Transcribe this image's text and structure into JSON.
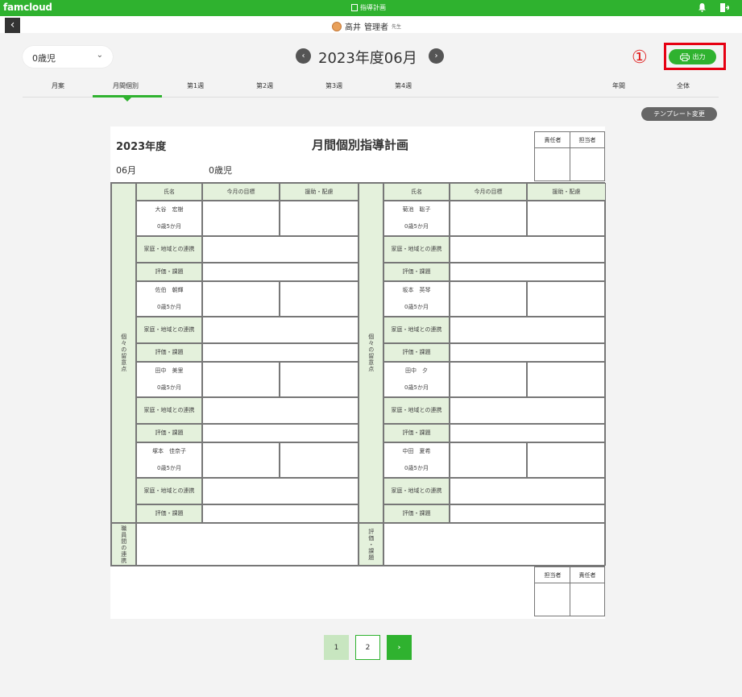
{
  "app": {
    "brand": "famcloud",
    "screen_title": "指導計画",
    "user_name": "高井",
    "user_role": "管理者",
    "user_suffix": "先生"
  },
  "toolbar": {
    "age_select_value": "0歳児",
    "month_label": "2023年度06月",
    "print_label": "出力",
    "annotation_marker": "①",
    "template_change_label": "テンプレート変更"
  },
  "tabs": [
    {
      "label": "月案"
    },
    {
      "label": "月間個別"
    },
    {
      "label": "第1週"
    },
    {
      "label": "第2週"
    },
    {
      "label": "第3週"
    },
    {
      "label": "第4週"
    },
    {
      "label": "年間"
    },
    {
      "label": "全体"
    }
  ],
  "document": {
    "year": "2023年度",
    "title": "月間個別指導計画",
    "month": "06月",
    "class": "0歳児",
    "top_sign_headers": [
      "責任者",
      "担当者"
    ],
    "bottom_sign_headers": [
      "担当者",
      "責任者"
    ],
    "column_headers": [
      "氏名",
      "今月の目標",
      "援助・配慮"
    ],
    "side_label": "個々の留意点",
    "row_label_family": "家庭・地域との連携",
    "row_label_eval": "評価・課題",
    "children_left": [
      {
        "name": "大谷　宏樹",
        "age": "0歳5か月"
      },
      {
        "name": "佐伯　朝輝",
        "age": "0歳5か月"
      },
      {
        "name": "田中　美里",
        "age": "0歳5か月"
      },
      {
        "name": "塚本　佳奈子",
        "age": "0歳5か月"
      }
    ],
    "children_right": [
      {
        "name": "菊池　聡子",
        "age": "0歳5か月"
      },
      {
        "name": "坂本　英琴",
        "age": "0歳5か月"
      },
      {
        "name": "田中　夕",
        "age": "0歳5か月"
      },
      {
        "name": "中田　夏希",
        "age": "0歳5か月"
      }
    ],
    "footer_left_label": "職員間の連携",
    "footer_right_label": "評価・課題"
  },
  "pagination": {
    "pages": [
      "1",
      "2"
    ],
    "next": "›"
  }
}
